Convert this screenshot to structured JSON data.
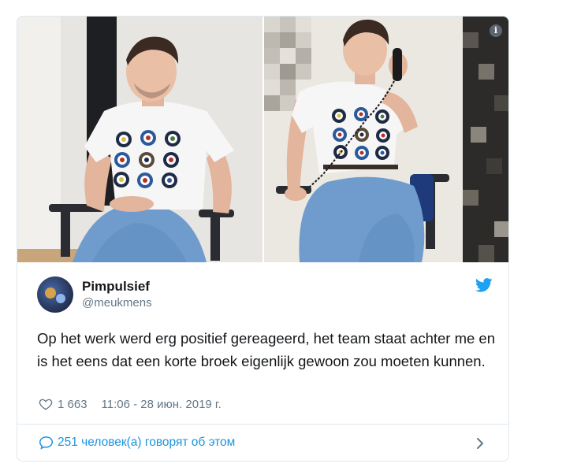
{
  "tweet": {
    "author_name": "Pimpulsief",
    "author_handle": "@meukmens",
    "text": "Op het werk werd erg positief gereageerd, het team staat achter me en is het eens dat een korte broek eigenlijk gewoon zou moeten kunnen.",
    "likes": "1 663",
    "timestamp": "11:06 - 28 июн. 2019 г.",
    "talking_about": "251 человек(а) говорят об этом"
  },
  "icons": {
    "info": "info-icon",
    "twitter": "twitter-bird-icon",
    "heart": "heart-icon",
    "bubble": "speech-bubble-icon",
    "chevron": "chevron-right-icon"
  },
  "colors": {
    "accent": "#1b95e0",
    "muted": "#657786",
    "border": "#e1e8ed",
    "text": "#14171a"
  }
}
